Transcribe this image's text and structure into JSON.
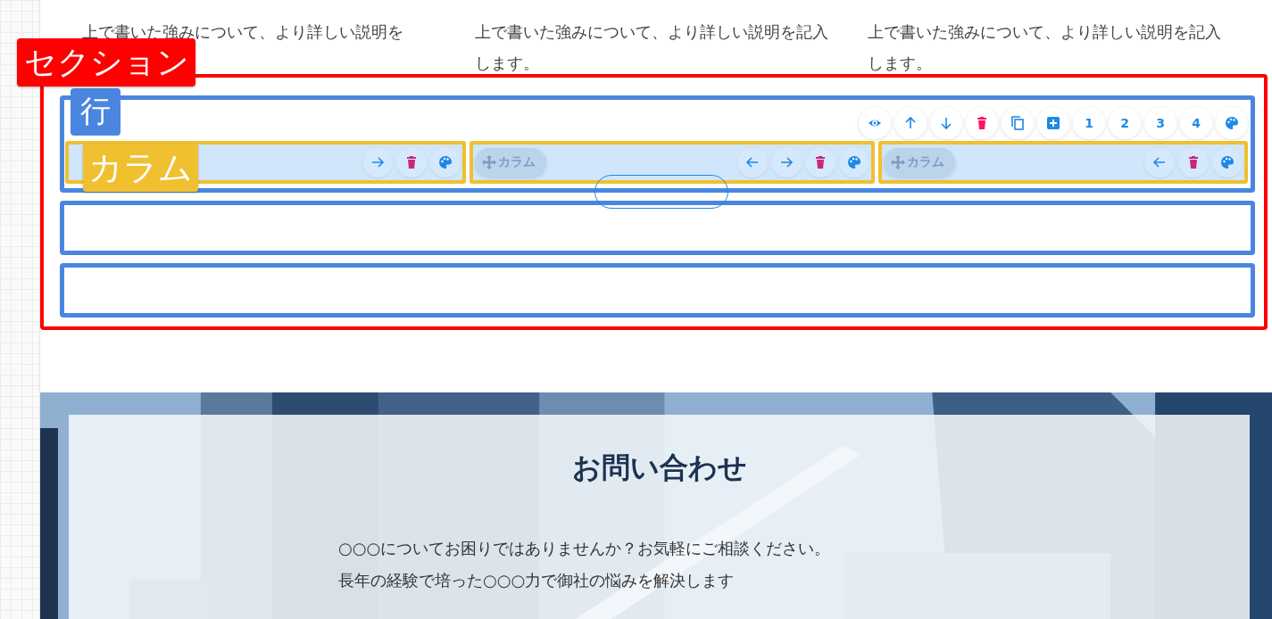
{
  "feature_texts": [
    "上で書いた強みについて、より詳しい説明を",
    "上で書いた強みについて、より詳しい説明を記入します。",
    "上で書いた強みについて、より詳しい説明を記入します。"
  ],
  "editor_labels": {
    "section": "セクション",
    "row": "行",
    "column": "カラム"
  },
  "rows": [
    {
      "kind": "columns",
      "toolbar": [
        {
          "kind": "eye"
        },
        {
          "kind": "up"
        },
        {
          "kind": "down"
        },
        {
          "kind": "trash"
        },
        {
          "kind": "copy"
        },
        {
          "kind": "add"
        },
        {
          "kind": "number",
          "text": "1"
        },
        {
          "kind": "number",
          "text": "2"
        },
        {
          "kind": "number",
          "text": "3"
        },
        {
          "kind": "number",
          "text": "4"
        },
        {
          "kind": "palette"
        }
      ],
      "columns": [
        {
          "buttons": [
            {
              "kind": "right"
            },
            {
              "kind": "trash"
            },
            {
              "kind": "palette"
            }
          ]
        },
        {
          "handle_label": "カラム",
          "buttons": [
            {
              "kind": "left"
            },
            {
              "kind": "right"
            },
            {
              "kind": "trash"
            },
            {
              "kind": "palette"
            }
          ]
        },
        {
          "handle_label": "カラム",
          "buttons": [
            {
              "kind": "left"
            },
            {
              "kind": "trash"
            },
            {
              "kind": "palette"
            }
          ]
        }
      ]
    },
    {
      "kind": "empty"
    },
    {
      "kind": "empty"
    }
  ],
  "close_button": {
    "kind": "pill"
  },
  "contact": {
    "background": {
      "kind": "picture"
    },
    "title": "お問い合わせ",
    "lines": [
      "○○○についてお困りではありませんか？お気軽にご相談ください。",
      "長年の経験で培った○○○力で御社の悩みを解決します"
    ]
  }
}
